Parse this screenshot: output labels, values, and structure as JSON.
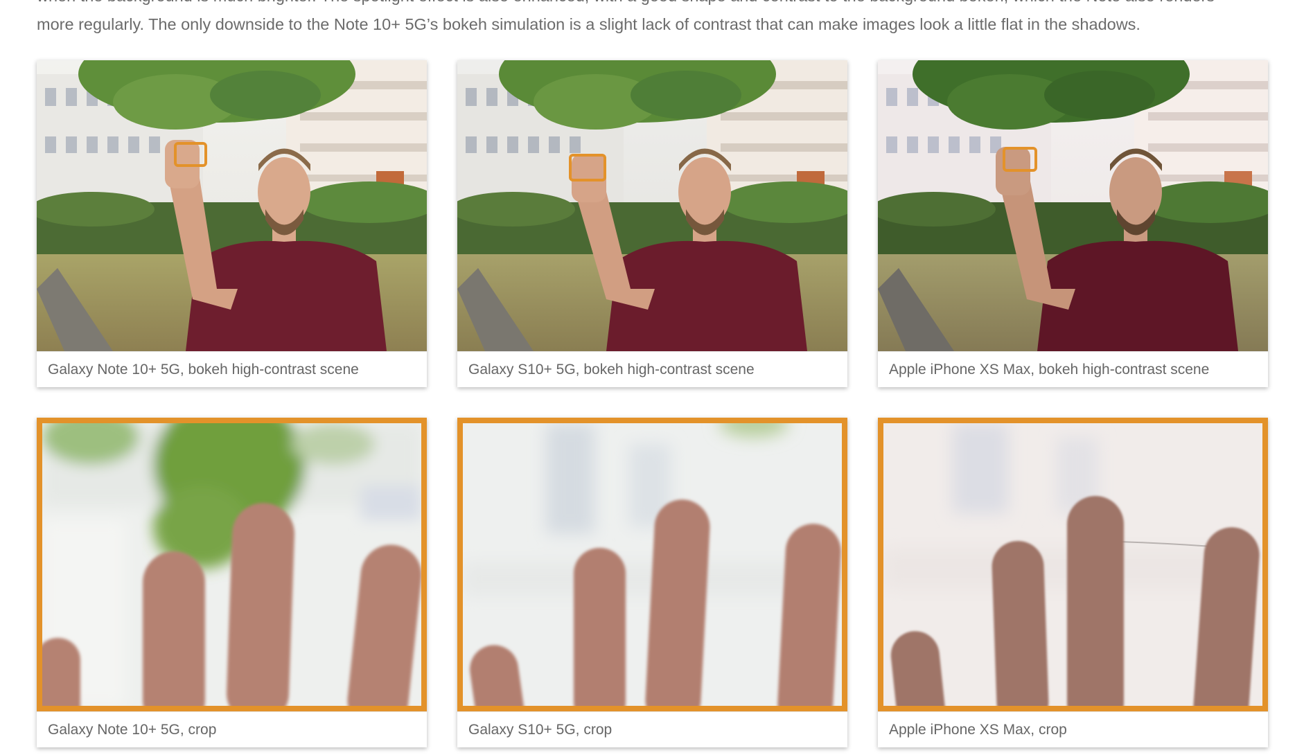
{
  "article": {
    "lines": [
      "when the background is much brighter. The spotlight effect is also enhanced, with a good shape and contrast to the background bokeh, which the Note also renders",
      "more regularly. The only downside to the Note 10+ 5G’s bokeh simulation is a slight lack of contrast that can make images look a little flat in the shadows."
    ]
  },
  "gallery": {
    "scenes": [
      {
        "caption": "Galaxy Note 10+ 5G, bokeh high-contrast scene"
      },
      {
        "caption": "Galaxy S10+ 5G, bokeh high-contrast scene"
      },
      {
        "caption": "Apple iPhone XS Max, bokeh high-contrast scene"
      }
    ],
    "crops": [
      {
        "caption": "Galaxy Note 10+ 5G, crop"
      },
      {
        "caption": "Galaxy S10+ 5G, crop"
      },
      {
        "caption": "Apple iPhone XS Max, crop"
      }
    ]
  },
  "colors": {
    "crop_highlight": "#e3922a",
    "body_text": "#6b6b6b",
    "caption_text": "#666666"
  }
}
